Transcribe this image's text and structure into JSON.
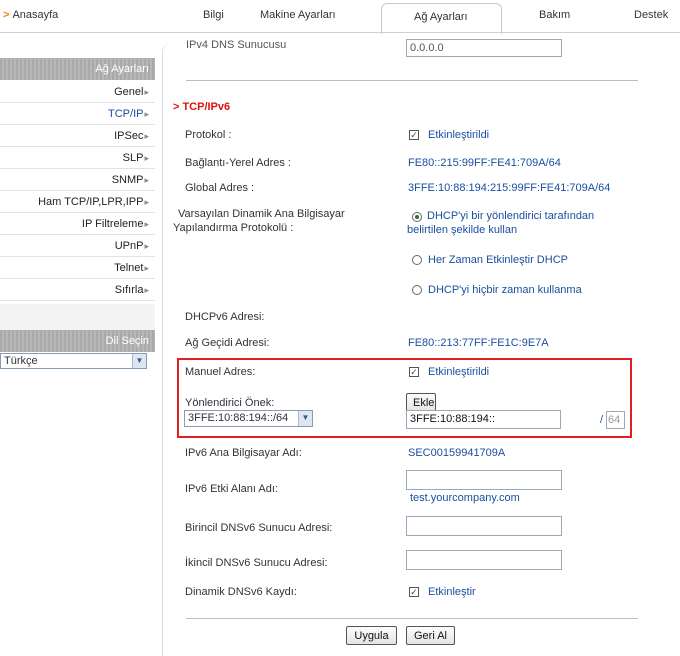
{
  "nav": {
    "home": "Anasayfa",
    "tabs": [
      "Bilgi",
      "Makine Ayarları",
      "Ağ Ayarları",
      "Bakım",
      "Destek"
    ],
    "active_tab": "Ağ Ayarları"
  },
  "sidebar": {
    "header": "Ağ Ayarları",
    "items": [
      "Genel",
      "TCP/IP",
      "IPSec",
      "SLP",
      "SNMP",
      "Ham TCP/IP,LPR,IPP",
      "IP Filtreleme",
      "UPnP",
      "Telnet",
      "Sıfırla"
    ],
    "active_item": "TCP/IP",
    "lang_header": "Dil Seçin",
    "lang_value": "Türkçe"
  },
  "main": {
    "partial_label": "IPv4 DNS Sunucusu",
    "partial_value": "0.0.0.0",
    "section_title": "TCP/IPv6",
    "protocol_label": "Protokol :",
    "protocol_value": "Etkinleştirildi",
    "link_local_label": "Bağlantı-Yerel Adres :",
    "link_local_value": "FE80::215:99FF:FE41:709A/64",
    "global_label": "Global Adres :",
    "global_value": "3FFE:10:88:194:215:99FF:FE41:709A/64",
    "dhcp_label_1": "Varsayılan Dinamik Ana Bilgisayar",
    "dhcp_label_2": "Yapılandırma Protokolü :",
    "dhcp_opt1_line1": "DHCP'yi bir yönlendirici tarafından",
    "dhcp_opt1_line2": "belirtilen şekilde kullan",
    "dhcp_opt2": "Her Zaman Etkinleştir DHCP",
    "dhcp_opt3": "DHCP'yi hiçbir zaman kullanma",
    "dhcpv6_label": "DHCPv6 Adresi:",
    "gateway_label": "Ağ Geçidi Adresi:",
    "gateway_value": "FE80::213:77FF:FE1C:9E7A",
    "manual_label": "Manuel Adres:",
    "manual_value": "Etkinleştirildi",
    "prefix_label": "Yönlendirici Önek:",
    "prefix_select": "3FFE:10:88:194::/64",
    "add_button": "Ekle",
    "prefix_input": "3FFE:10:88:194::",
    "prefix_len_sep": "/",
    "prefix_len": "64",
    "hostname_label": "IPv6 Ana Bilgisayar Adı:",
    "hostname_value": "SEC00159941709A",
    "domain_label": "IPv6 Etki Alanı Adı:",
    "domain_value": "test.yourcompany.com",
    "dns1_label": "Birincil DNSv6 Sunucu Adresi:",
    "dns2_label": "İkincil DNSv6 Sunucu Adresi:",
    "ddns_label": "Dinamik DNSv6 Kaydı:",
    "ddns_value": "Etkinleştir",
    "apply_button": "Uygula",
    "undo_button": "Geri Al"
  },
  "colors": {
    "link_blue": "#1a4fa0",
    "accent_red": "#e02020",
    "nav_orange": "#f08a00"
  }
}
